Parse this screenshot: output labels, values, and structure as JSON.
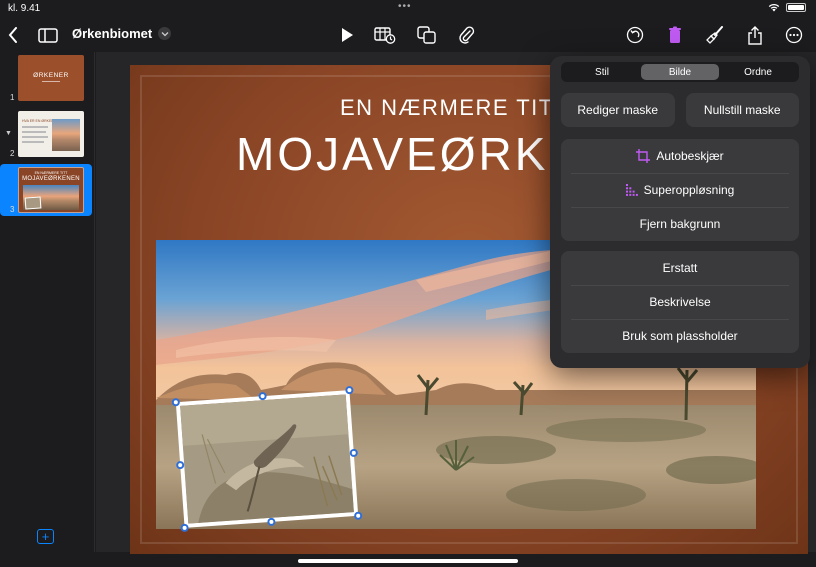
{
  "status_bar": {
    "time": "kl. 9.41",
    "battery_level": 1.0
  },
  "toolbar": {
    "document_title": "Ørkenbiomet",
    "icons": [
      "chevron-left-icon",
      "sidebar-toggle-icon",
      "chevron-down-icon",
      "play-icon",
      "table-insert-icon",
      "shapes-icon",
      "paperclip-icon",
      "undo-icon",
      "trash-icon",
      "paintbrush-icon",
      "share-icon",
      "more-icon"
    ],
    "accent": "#0a84ff",
    "active_icon_color": "#bf5af2"
  },
  "sidebar": {
    "slides": [
      {
        "number": "1",
        "thumb_title": "ØRKENER"
      },
      {
        "number": "2",
        "thumb_title": "HVA ER EN ØRKEN?"
      },
      {
        "number": "3",
        "thumb_subtitle": "EN NÆRMERE TITT",
        "thumb_title": "MOJAVEØRKENEN"
      }
    ],
    "selected_slide": "3"
  },
  "slide": {
    "subtitle": "EN NÆRMERE TITT",
    "title": "MOJAVEØRKENEN"
  },
  "popover": {
    "tabs": [
      "Stil",
      "Bilde",
      "Ordne"
    ],
    "active_tab": "Bilde",
    "mask_buttons": [
      "Rediger maske",
      "Nullstill maske"
    ],
    "group1": [
      "Autobeskjær",
      "Superoppløsning",
      "Fjern bakgrunn"
    ],
    "group2": [
      "Erstatt",
      "Beskrivelse",
      "Bruk som plassholder"
    ]
  }
}
